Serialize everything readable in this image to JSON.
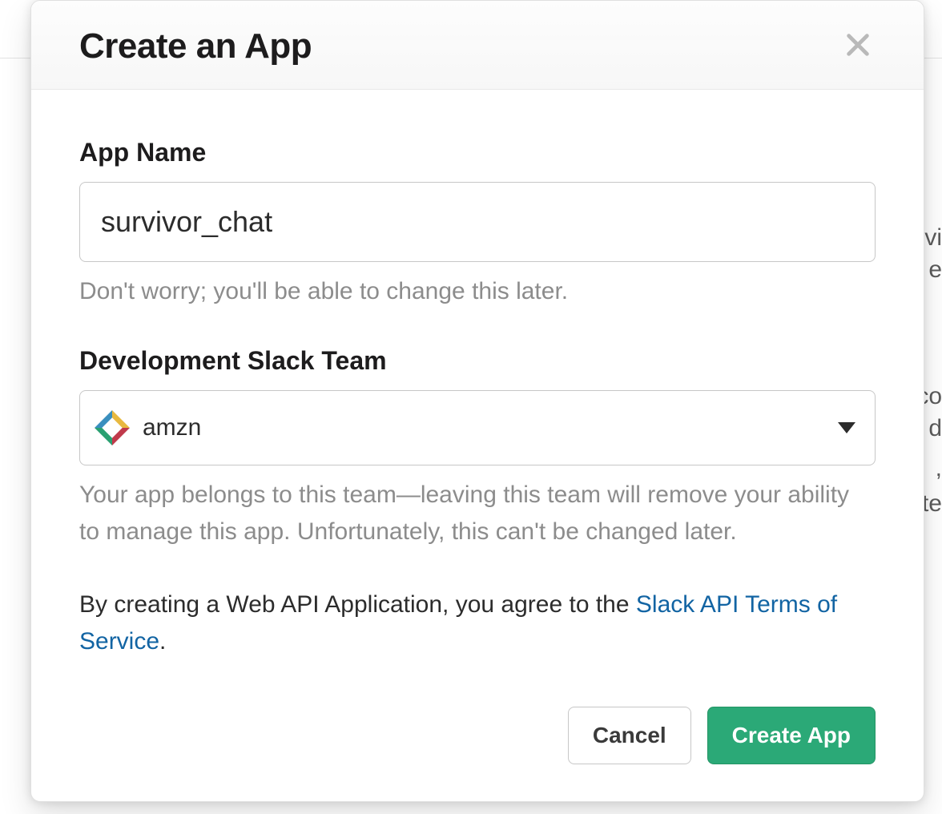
{
  "modal": {
    "title": "Create an App",
    "app_name": {
      "label": "App Name",
      "value": "survivor_chat",
      "helper": "Don't worry; you'll be able to change this later."
    },
    "team": {
      "label": "Development Slack Team",
      "selected": "amzn",
      "helper": "Your app belongs to this team—leaving this team will remove your ability to manage this app. Unfortunately, this can't be changed later."
    },
    "agreement": {
      "prefix": "By creating a Web API Application, you agree to the ",
      "link_text": "Slack API Terms of Service",
      "suffix": "."
    },
    "buttons": {
      "cancel": "Cancel",
      "create": "Create App"
    }
  },
  "bg_fragments": [
    "vi",
    "e",
    "co",
    "d",
    ",",
    "te"
  ]
}
